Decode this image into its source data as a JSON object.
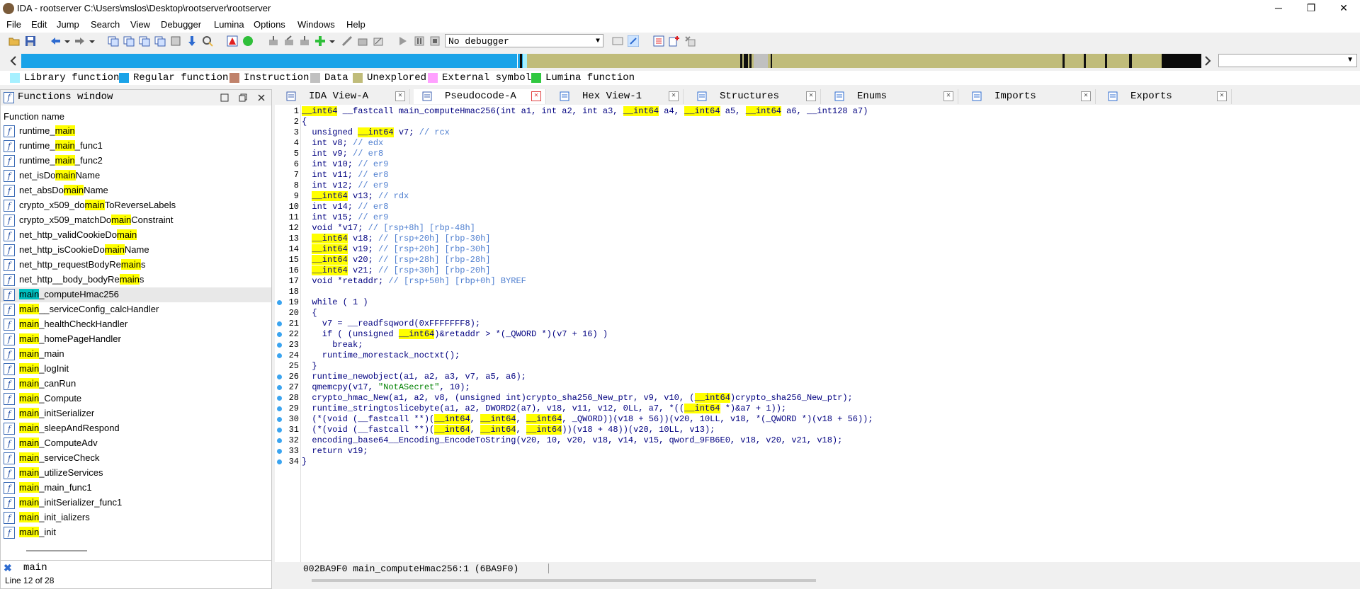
{
  "window": {
    "title": "IDA - rootserver C:\\Users\\mslos\\Desktop\\rootserver\\rootserver",
    "minimize": "─",
    "maximize": "❐",
    "close": "✕"
  },
  "menu": [
    "File",
    "Edit",
    "Jump",
    "Search",
    "View",
    "Debugger",
    "Lumina",
    "Options",
    "Windows",
    "Help"
  ],
  "toolbar": {
    "debugger_select": "No debugger"
  },
  "legend": [
    {
      "label": "Library function",
      "color": "#a6f0ff"
    },
    {
      "label": "Regular function",
      "color": "#1aa3e8"
    },
    {
      "label": "Instruction",
      "color": "#c0826b"
    },
    {
      "label": "Data",
      "color": "#c0c0c0"
    },
    {
      "label": "Unexplored",
      "color": "#c0bc7a"
    },
    {
      "label": "External symbol",
      "color": "#ffa0ff"
    },
    {
      "label": "Lumina function",
      "color": "#30c840"
    }
  ],
  "functions_window": {
    "title": "Functions window",
    "column_header": "Function name",
    "icon_letter": "f",
    "filter_value": "main",
    "status": "Line 12 of 28",
    "items": [
      {
        "pre": "runtime_",
        "hl": "main",
        "post": ""
      },
      {
        "pre": "runtime_",
        "hl": "main",
        "post": "_func1"
      },
      {
        "pre": "runtime_",
        "hl": "main",
        "post": "_func2"
      },
      {
        "pre": "net_isDo",
        "hl": "main",
        "post": "Name"
      },
      {
        "pre": "net_absDo",
        "hl": "main",
        "post": "Name"
      },
      {
        "pre": "crypto_x509_do",
        "hl": "main",
        "post": "ToReverseLabels"
      },
      {
        "pre": "crypto_x509_matchDo",
        "hl": "main",
        "post": "Constraint"
      },
      {
        "pre": "net_http_validCookieDo",
        "hl": "main",
        "post": ""
      },
      {
        "pre": "net_http_isCookieDo",
        "hl": "main",
        "post": "Name"
      },
      {
        "pre": "net_http_requestBodyRe",
        "hl": "main",
        "post": "s"
      },
      {
        "pre": "net_http__body_bodyRe",
        "hl": "main",
        "post": "s"
      },
      {
        "pre": "",
        "hl": "main",
        "post": "_computeHmac256",
        "selected": true
      },
      {
        "pre": "",
        "hl": "main",
        "post": "__serviceConfig_calcHandler"
      },
      {
        "pre": "",
        "hl": "main",
        "post": "_healthCheckHandler"
      },
      {
        "pre": "",
        "hl": "main",
        "post": "_homePageHandler"
      },
      {
        "pre": "",
        "hl": "main",
        "post": "_main"
      },
      {
        "pre": "",
        "hl": "main",
        "post": "_logInit"
      },
      {
        "pre": "",
        "hl": "main",
        "post": "_canRun"
      },
      {
        "pre": "",
        "hl": "main",
        "post": "_Compute"
      },
      {
        "pre": "",
        "hl": "main",
        "post": "_initSerializer"
      },
      {
        "pre": "",
        "hl": "main",
        "post": "_sleepAndRespond"
      },
      {
        "pre": "",
        "hl": "main",
        "post": "_ComputeAdv"
      },
      {
        "pre": "",
        "hl": "main",
        "post": "_serviceCheck"
      },
      {
        "pre": "",
        "hl": "main",
        "post": "_utilizeServices"
      },
      {
        "pre": "",
        "hl": "main",
        "post": "_main_func1"
      },
      {
        "pre": "",
        "hl": "main",
        "post": "_initSerializer_func1"
      },
      {
        "pre": "",
        "hl": "main",
        "post": "_init_ializers"
      },
      {
        "pre": "",
        "hl": "main",
        "post": "_init"
      }
    ]
  },
  "tabs": [
    {
      "label": "IDA View-A",
      "active": false
    },
    {
      "label": "Pseudocode-A",
      "active": true
    },
    {
      "label": "Hex View-1",
      "active": false
    },
    {
      "label": "Structures",
      "active": false
    },
    {
      "label": "Enums",
      "active": false
    },
    {
      "label": "Imports",
      "active": false
    },
    {
      "label": "Exports",
      "active": false
    }
  ],
  "code": {
    "breakpoint_lines": [
      19,
      21,
      22,
      23,
      24,
      26,
      27,
      28,
      29,
      30,
      31,
      32,
      33,
      34
    ],
    "lines": [
      [
        {
          "t": "__int64",
          "c": "hl"
        },
        {
          "t": " __fastcall main_computeHmac256(int a1, int a2, int a3, "
        },
        {
          "t": "__int64",
          "c": "hl"
        },
        {
          "t": " a4, "
        },
        {
          "t": "__int64",
          "c": "hl"
        },
        {
          "t": " a5, "
        },
        {
          "t": "__int64",
          "c": "hl"
        },
        {
          "t": " a6, __int128 a7)"
        }
      ],
      [
        {
          "t": "{"
        }
      ],
      [
        {
          "t": "  unsigned "
        },
        {
          "t": "__int64",
          "c": "hl"
        },
        {
          "t": " v7; "
        },
        {
          "t": "// rcx",
          "c": "cm"
        }
      ],
      [
        {
          "t": "  int v8; "
        },
        {
          "t": "// edx",
          "c": "cm"
        }
      ],
      [
        {
          "t": "  int v9; "
        },
        {
          "t": "// er8",
          "c": "cm"
        }
      ],
      [
        {
          "t": "  int v10; "
        },
        {
          "t": "// er9",
          "c": "cm"
        }
      ],
      [
        {
          "t": "  int v11; "
        },
        {
          "t": "// er8",
          "c": "cm"
        }
      ],
      [
        {
          "t": "  int v12; "
        },
        {
          "t": "// er9",
          "c": "cm"
        }
      ],
      [
        {
          "t": "  "
        },
        {
          "t": "__int64",
          "c": "hl"
        },
        {
          "t": " v13; "
        },
        {
          "t": "// rdx",
          "c": "cm"
        }
      ],
      [
        {
          "t": "  int v14; "
        },
        {
          "t": "// er8",
          "c": "cm"
        }
      ],
      [
        {
          "t": "  int v15; "
        },
        {
          "t": "// er9",
          "c": "cm"
        }
      ],
      [
        {
          "t": "  void *v17; "
        },
        {
          "t": "// [rsp+8h] [rbp-48h]",
          "c": "cm"
        }
      ],
      [
        {
          "t": "  "
        },
        {
          "t": "__int64",
          "c": "hl"
        },
        {
          "t": " v18; "
        },
        {
          "t": "// [rsp+20h] [rbp-30h]",
          "c": "cm"
        }
      ],
      [
        {
          "t": "  "
        },
        {
          "t": "__int64",
          "c": "hl"
        },
        {
          "t": " v19; "
        },
        {
          "t": "// [rsp+20h] [rbp-30h]",
          "c": "cm"
        }
      ],
      [
        {
          "t": "  "
        },
        {
          "t": "__int64",
          "c": "hl"
        },
        {
          "t": " v20; "
        },
        {
          "t": "// [rsp+28h] [rbp-28h]",
          "c": "cm"
        }
      ],
      [
        {
          "t": "  "
        },
        {
          "t": "__int64",
          "c": "hl"
        },
        {
          "t": " v21; "
        },
        {
          "t": "// [rsp+30h] [rbp-20h]",
          "c": "cm"
        }
      ],
      [
        {
          "t": "  void *retaddr; "
        },
        {
          "t": "// [rsp+50h] [rbp+0h] BYREF",
          "c": "cm"
        }
      ],
      [
        {
          "t": ""
        }
      ],
      [
        {
          "t": "  while ( 1 )"
        }
      ],
      [
        {
          "t": "  {"
        }
      ],
      [
        {
          "t": "    v7 = __readfsqword(0xFFFFFFF8);"
        }
      ],
      [
        {
          "t": "    if ( (unsigned "
        },
        {
          "t": "__int64",
          "c": "hl"
        },
        {
          "t": ")&retaddr > *(_QWORD *)(v7 + 16) )"
        }
      ],
      [
        {
          "t": "      break;"
        }
      ],
      [
        {
          "t": "    runtime_morestack_noctxt();"
        }
      ],
      [
        {
          "t": "  }"
        }
      ],
      [
        {
          "t": "  runtime_newobject(a1, a2, a3, v7, a5, a6);"
        }
      ],
      [
        {
          "t": "  qmemcpy(v17, "
        },
        {
          "t": "\"NotASecret\"",
          "c": "st"
        },
        {
          "t": ", 10);"
        }
      ],
      [
        {
          "t": "  crypto_hmac_New(a1, a2, v8, (unsigned int)crypto_sha256_New_ptr, v9, v10, ("
        },
        {
          "t": "__int64",
          "c": "hl"
        },
        {
          "t": ")crypto_sha256_New_ptr);"
        }
      ],
      [
        {
          "t": "  runtime_stringtoslicebyte(a1, a2, DWORD2(a7), v18, v11, v12, 0LL, a7, *(("
        },
        {
          "t": "__int64",
          "c": "hl"
        },
        {
          "t": " *)&a7 + 1));"
        }
      ],
      [
        {
          "t": "  (*(void (__fastcall **)("
        },
        {
          "t": "__int64",
          "c": "hl"
        },
        {
          "t": ", "
        },
        {
          "t": "__int64",
          "c": "hl"
        },
        {
          "t": ", "
        },
        {
          "t": "__int64",
          "c": "hl"
        },
        {
          "t": ", _QWORD))(v18 + 56))(v20, 10LL, v18, *(_QWORD *)(v18 + 56));"
        }
      ],
      [
        {
          "t": "  (*(void (__fastcall **)("
        },
        {
          "t": "__int64",
          "c": "hl"
        },
        {
          "t": ", "
        },
        {
          "t": "__int64",
          "c": "hl"
        },
        {
          "t": ", "
        },
        {
          "t": "__int64",
          "c": "hl"
        },
        {
          "t": "))(v18 + 48))(v20, 10LL, v13);"
        }
      ],
      [
        {
          "t": "  encoding_base64__Encoding_EncodeToString(v20, 10, v20, v18, v14, v15, qword_9FB6E0, v18, v20, v21, v18);"
        }
      ],
      [
        {
          "t": "  return v19;"
        }
      ],
      [
        {
          "t": "}"
        }
      ]
    ]
  },
  "status_line": "002BA9F0 main_computeHmac256:1 (6BA9F0)"
}
